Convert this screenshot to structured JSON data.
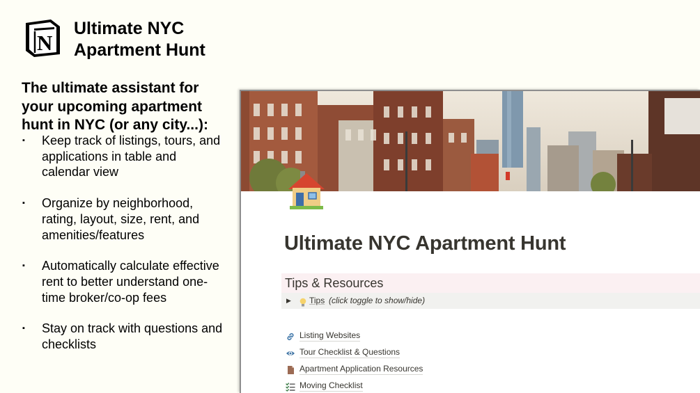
{
  "brand": {
    "logo_icon": "notion-logo-icon",
    "title_line1": "Ultimate NYC",
    "title_line2": "Apartment Hunt"
  },
  "intro": {
    "text": "The ultimate assistant for your upcoming apartment hunt in NYC (or any city...):"
  },
  "features": [
    "Keep track of listings, tours, and applications in table and calendar view",
    "Organize by neighborhood, rating, layout, size, rent, and amenities/features",
    "Automatically calculate effective rent to better understand one-time broker/co-op fees",
    "Stay on track with questions and checklists"
  ],
  "bullet_glyph": "▪",
  "notion_page": {
    "cover": "nyc-street-cover-image",
    "icon": "house-icon",
    "title": "Ultimate NYC Apartment Hunt",
    "heading": "Tips & Resources",
    "toggle": {
      "arrow": "▶",
      "icon": "lightbulb-icon",
      "label": "Tips",
      "hint": "(click toggle to show/hide)"
    },
    "links": [
      {
        "icon": "link-icon",
        "label": "Listing Websites"
      },
      {
        "icon": "eye-icon",
        "label": "Tour Checklist & Questions"
      },
      {
        "icon": "document-icon",
        "label": "Apartment Application Resources"
      },
      {
        "icon": "checklist-icon",
        "label": "Moving Checklist"
      }
    ]
  },
  "colors": {
    "slide_background": "#fefef6",
    "notion_text": "#37352f",
    "heading_highlight": "#fbf0f2",
    "toggle_background": "#f1f1ef"
  }
}
